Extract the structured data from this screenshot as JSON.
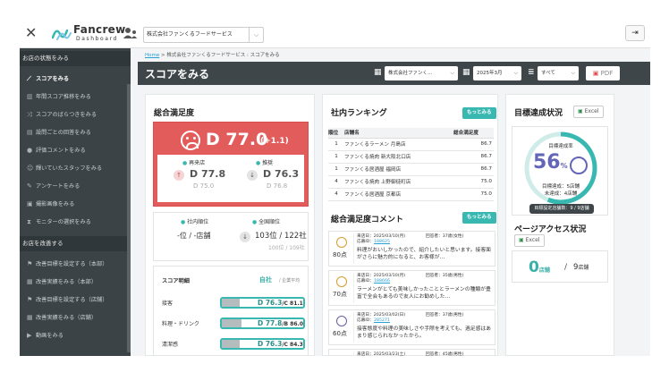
{
  "app": {
    "brand": "Fancrew",
    "brand_sub": "Dashboard",
    "company": "株式会社ファンくるフードサービス",
    "logout_icon": "logout-icon"
  },
  "sidebar": {
    "section1": "お店の状態をみる",
    "items1": [
      {
        "label": "スコアをみる",
        "icon": "chart-icon",
        "active": true
      },
      {
        "label": "年間スコア推移をみる",
        "icon": "bar-chart-icon"
      },
      {
        "label": "スコアのばらつきをみる",
        "icon": "shuffle-icon"
      },
      {
        "label": "設問ごとの回答をみる",
        "icon": "clipboard-icon"
      },
      {
        "label": "評価コメントをみる",
        "icon": "comment-icon"
      },
      {
        "label": "輝いていたスタッフをみる",
        "icon": "users-icon"
      },
      {
        "label": "アンケートをみる",
        "icon": "edit-icon"
      },
      {
        "label": "撮影画像をみる",
        "icon": "image-icon"
      },
      {
        "label": "モニターの選択をみる",
        "icon": "hourglass-icon"
      }
    ],
    "section2": "お店を改善する",
    "items2": [
      {
        "label": "改善目標を設定する（本部）",
        "icon": "flag-icon"
      },
      {
        "label": "改善実績をみる（本部）",
        "icon": "table-icon"
      },
      {
        "label": "改善目標を設定する（店舗）",
        "icon": "flag-icon"
      },
      {
        "label": "改善実績をみる（店舗）",
        "icon": "table-icon"
      },
      {
        "label": "動画をみる",
        "icon": "video-icon"
      }
    ]
  },
  "breadcrumb": {
    "home": "Home",
    "rest": "> 株式会社ファンくるフードサービス : スコアをみる"
  },
  "header": {
    "title": "スコアをみる",
    "store_select": "株式会社ファンく…",
    "month_select": "2025年3月",
    "filter_select": "すべて",
    "pdf_label": "PDF"
  },
  "overall": {
    "title": "総合満足度",
    "score": "D 77.0",
    "delta": "(+1.1)",
    "repeat_label": "再来店",
    "repeat_value": "D 77.8",
    "repeat_prev": "D 75.0",
    "recommend_label": "推奨",
    "recommend_value": "D 76.3",
    "recommend_prev": "D 76.8",
    "internal_rank_label": "社内順位",
    "internal_rank_value": "-位 / -店舗",
    "national_rank_label": "全国順位",
    "national_rank_value": "103位 / 122社",
    "national_rank_prev": "100位 / 109社",
    "detail_header": "スコア明細",
    "detail_col_self": "自社",
    "detail_col_avg": "/ 企業平均",
    "details": [
      {
        "name": "接客",
        "value": "D 76.3",
        "avg": "C 81.1",
        "fill": 0.22
      },
      {
        "name": "料理・ドリンク",
        "value": "D 77.8",
        "avg": "B 86.0",
        "fill": 0.24
      },
      {
        "name": "清潔感",
        "value": "D 76.3",
        "avg": "C 84.3",
        "fill": 0.22
      }
    ]
  },
  "ranking": {
    "title": "社内ランキング",
    "more": "もっとみる",
    "columns": [
      "順位",
      "店舗名",
      "総合満足度"
    ],
    "rows": [
      [
        "1",
        "ファンくるラーメン 月島店",
        "86.7"
      ],
      [
        "1",
        "ファンくる焼肉 新大阪北口店",
        "86.7"
      ],
      [
        "1",
        "ファンくる居酒屋 福岡店",
        "86.7"
      ],
      [
        "4",
        "ファンくる焼肉 上野御徒町店",
        "75.0"
      ],
      [
        "4",
        "ファンくる居酒屋 京都店",
        "75.0"
      ]
    ]
  },
  "comments": {
    "title": "総合満足度コメント",
    "more": "もっとみる",
    "items": [
      {
        "points": "80点",
        "date": "来店日：2025/03/10(月)",
        "id_label": "応募ID：",
        "id": "188625",
        "customer": "回答者：37歳(女性)",
        "text": "料理がおいしかったので、紹介したいと思います。接客面がさらに魅力的になると、お客様が…",
        "face": "warm"
      },
      {
        "points": "70点",
        "date": "来店日：2025/03/10(月)",
        "id_label": "応募ID：",
        "id": "188666",
        "customer": "回答者：35歳(男性)",
        "text": "ラーメンがとても美味しかったこととラーメンの種類が豊富で全会もあるので友人にお勧めした…",
        "face": "warm"
      },
      {
        "points": "60点",
        "date": "来店日：2025/03/02(日)",
        "id_label": "応募ID：",
        "id": "285271",
        "customer": "回答者：37歳(男性)",
        "text": "接客態度や料理の美味しさや手際を考えても、過足感はあまり感じられなかったから。",
        "face": "purp"
      },
      {
        "points": "",
        "date": "来店日：2025/03/23(土)",
        "id_label": "",
        "id": "",
        "customer": "回答者：45歳(男性)",
        "text": "",
        "face": "none"
      }
    ]
  },
  "goal": {
    "title": "目標達成状況",
    "excel": "Excel",
    "rate_label": "目標達成率",
    "rate": "56",
    "rate_unit": "%",
    "achieved": "目標達成：5店舗",
    "not_achieved": "未達成：4店舗",
    "set_stores": "目標設定店舗数：9 / 9店舗"
  },
  "access": {
    "title": "ページアクセス状況",
    "excel": "Excel",
    "value": "0",
    "unit": "店舗",
    "total": "9",
    "total_unit": "店舗"
  }
}
